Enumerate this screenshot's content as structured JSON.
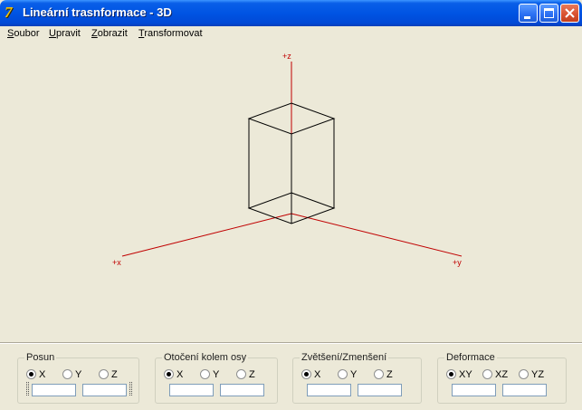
{
  "window": {
    "title": "Lineární trasnformace - 3D",
    "icon": "app-logo-icon",
    "controls": {
      "minimize_icon": "minimize-icon",
      "maximize_icon": "maximize-icon",
      "close_icon": "close-icon"
    }
  },
  "menu": [
    {
      "label": "Soubor",
      "accelerator": "S"
    },
    {
      "label": "Upravit",
      "accelerator": "U"
    },
    {
      "label": "Zobrazit",
      "accelerator": "Z"
    },
    {
      "label": "Transformovat",
      "accelerator": "T"
    }
  ],
  "scene": {
    "axes": {
      "z_label": "+z",
      "x_label": "+x",
      "y_label": "+y",
      "color": "#c00000"
    },
    "object_color": "#000000",
    "background": "#ece9d8"
  },
  "groups": [
    {
      "title": "Posun",
      "options": [
        {
          "label": "X",
          "selected": true
        },
        {
          "label": "Y",
          "selected": false
        },
        {
          "label": "Z",
          "selected": false
        }
      ],
      "fields": [
        "",
        ""
      ]
    },
    {
      "title": "Otočení kolem osy",
      "options": [
        {
          "label": "X",
          "selected": true
        },
        {
          "label": "Y",
          "selected": false
        },
        {
          "label": "Z",
          "selected": false
        }
      ],
      "fields": [
        "",
        ""
      ]
    },
    {
      "title": "Zvětšení/Zmenšení",
      "options": [
        {
          "label": "X",
          "selected": true
        },
        {
          "label": "Y",
          "selected": false
        },
        {
          "label": "Z",
          "selected": false
        }
      ],
      "fields": [
        "",
        ""
      ]
    },
    {
      "title": "Deformace",
      "options": [
        {
          "label": "XY",
          "selected": true
        },
        {
          "label": "XZ",
          "selected": false
        },
        {
          "label": "YZ",
          "selected": false
        }
      ],
      "fields": [
        "",
        ""
      ]
    }
  ]
}
